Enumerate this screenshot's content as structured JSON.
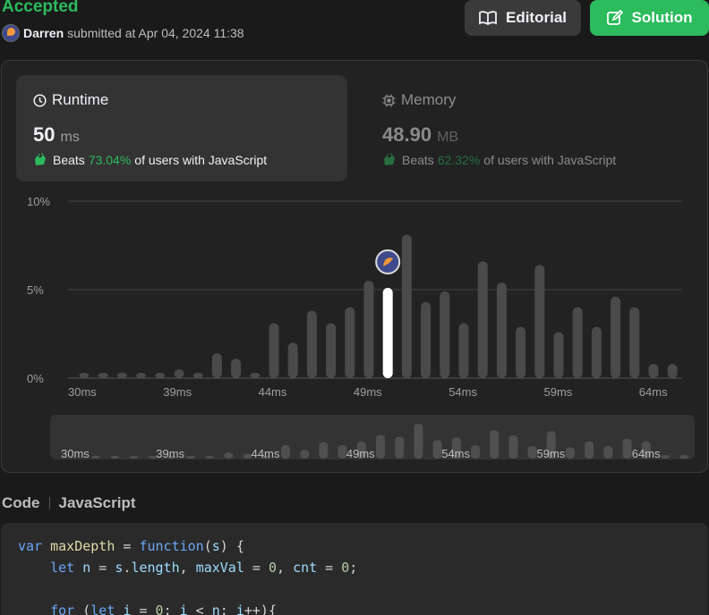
{
  "header": {
    "status": "Accepted",
    "submitter_name": "Darren",
    "submitted_text": "submitted at Apr 04, 2024 11:38",
    "editorial_label": "Editorial",
    "solution_label": "Solution"
  },
  "runtime": {
    "title": "Runtime",
    "value": "50",
    "unit": "ms",
    "beats_prefix": "Beats",
    "beats_pct": "73.04%",
    "beats_suffix": "of users with JavaScript"
  },
  "memory": {
    "title": "Memory",
    "value": "48.90",
    "unit": "MB",
    "beats_prefix": "Beats",
    "beats_pct": "62.32%",
    "beats_suffix": "of users with JavaScript"
  },
  "colors": {
    "accent": "#2cbb5d",
    "bar": "#4a4a4a",
    "bar_selected": "#ffffff"
  },
  "chart_data": [
    {
      "type": "bar",
      "categories": [
        "30ms",
        "31ms",
        "32ms",
        "33ms",
        "34ms",
        "35ms",
        "36ms",
        "37ms",
        "38ms",
        "39ms",
        "40ms",
        "41ms",
        "42ms",
        "43ms",
        "44ms",
        "45ms",
        "46ms",
        "47ms",
        "48ms",
        "49ms",
        "50ms",
        "51ms",
        "52ms",
        "53ms",
        "54ms",
        "55ms",
        "56ms",
        "57ms",
        "58ms",
        "59ms",
        "60ms",
        "61ms",
        "62ms",
        "63ms"
      ],
      "values": [
        0.3,
        0.3,
        0.3,
        0.3,
        0.3,
        0.5,
        0.3,
        1.4,
        1.1,
        0.3,
        3.1,
        2.0,
        3.8,
        3.1,
        4.0,
        5.5,
        5.1,
        8.1,
        4.3,
        4.9,
        3.1,
        6.6,
        5.4,
        2.9,
        6.4,
        2.6,
        4.0,
        2.9,
        4.6,
        4.0,
        0.8,
        0.8
      ],
      "xtick_labels": [
        "30ms",
        "39ms",
        "44ms",
        "49ms",
        "54ms",
        "59ms",
        "64ms"
      ],
      "ytick_labels": [
        "10%",
        "5%",
        "0%"
      ],
      "ylim": [
        0,
        10
      ],
      "selected_index": 16,
      "grid": true
    }
  ],
  "code": {
    "label": "Code",
    "language": "JavaScript",
    "lines": [
      [
        [
          "kw",
          "var "
        ],
        [
          "fn",
          "maxDepth"
        ],
        [
          "plain",
          " = "
        ],
        [
          "kw",
          "function"
        ],
        [
          "plain",
          "("
        ],
        [
          "var",
          "s"
        ],
        [
          "plain",
          ") {"
        ]
      ],
      [
        [
          "plain",
          "    "
        ],
        [
          "kw",
          "let "
        ],
        [
          "var",
          "n"
        ],
        [
          "plain",
          " = "
        ],
        [
          "var",
          "s"
        ],
        [
          "plain",
          "."
        ],
        [
          "var",
          "length"
        ],
        [
          "plain",
          ", "
        ],
        [
          "var",
          "maxVal"
        ],
        [
          "plain",
          " = "
        ],
        [
          "num",
          "0"
        ],
        [
          "plain",
          ", "
        ],
        [
          "var",
          "cnt"
        ],
        [
          "plain",
          " = "
        ],
        [
          "num",
          "0"
        ],
        [
          "plain",
          ";"
        ]
      ],
      [
        [
          "plain",
          ""
        ]
      ],
      [
        [
          "plain",
          "    "
        ],
        [
          "kw",
          "for"
        ],
        [
          "plain",
          " ("
        ],
        [
          "kw",
          "let "
        ],
        [
          "var",
          "i"
        ],
        [
          "plain",
          " = "
        ],
        [
          "num",
          "0"
        ],
        [
          "plain",
          "; "
        ],
        [
          "var",
          "i"
        ],
        [
          "plain",
          " < "
        ],
        [
          "var",
          "n"
        ],
        [
          "plain",
          "; "
        ],
        [
          "var",
          "i"
        ],
        [
          "plain",
          "++){"
        ]
      ]
    ]
  }
}
